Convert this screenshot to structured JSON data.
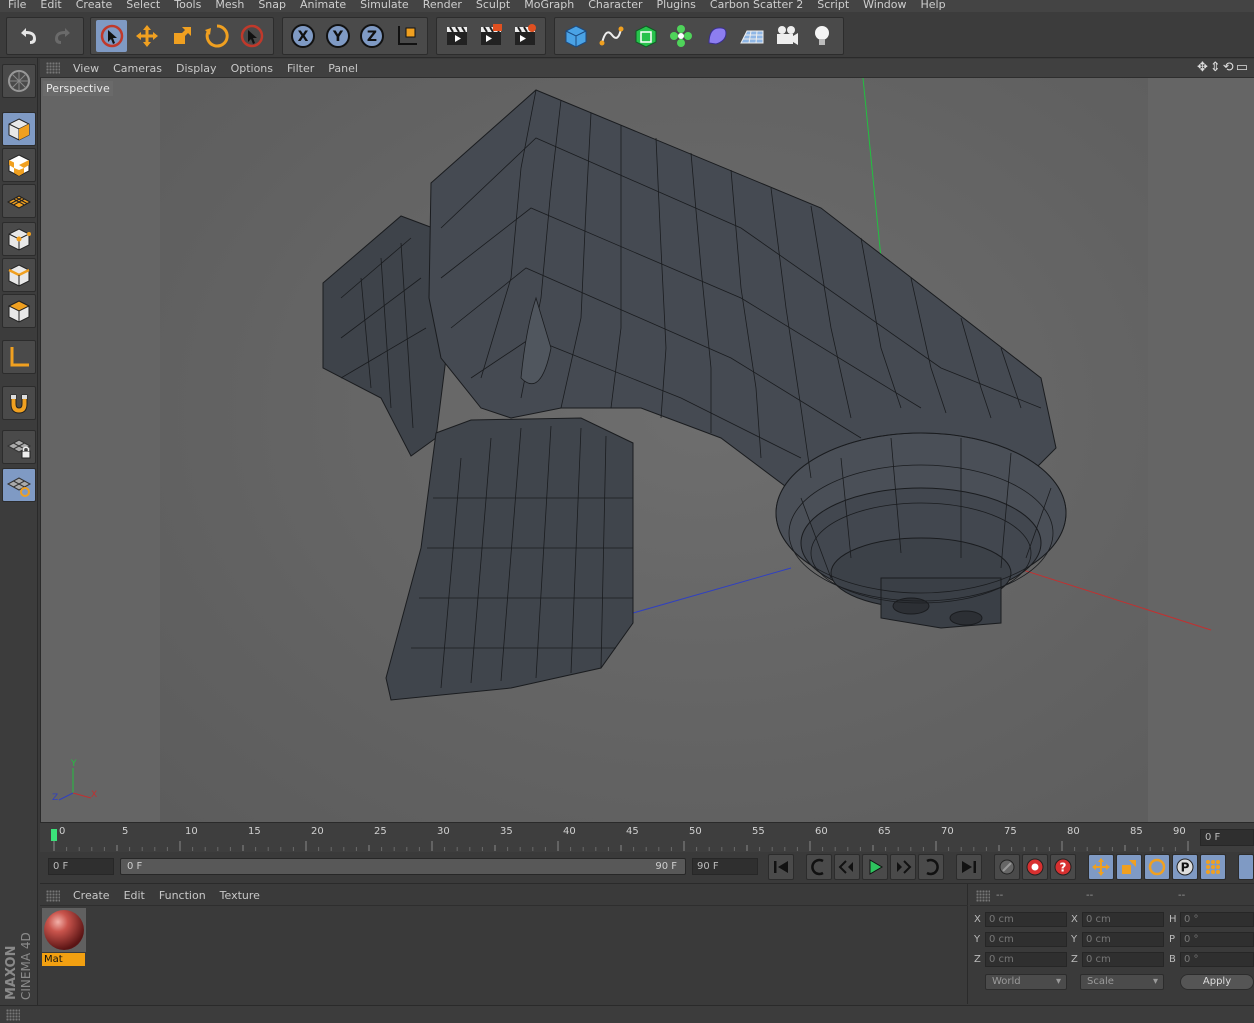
{
  "menu": [
    "File",
    "Edit",
    "Create",
    "Select",
    "Tools",
    "Mesh",
    "Snap",
    "Animate",
    "Simulate",
    "Render",
    "Sculpt",
    "MoGraph",
    "Character",
    "Plugins",
    "Carbon Scatter 2",
    "Script",
    "Window",
    "Help"
  ],
  "toolbar": {
    "axis_x": "X",
    "axis_y": "Y",
    "axis_z": "Z"
  },
  "viewport": {
    "menu": [
      "View",
      "Cameras",
      "Display",
      "Options",
      "Filter",
      "Panel"
    ],
    "camera_label": "Perspective",
    "axis_y": "Y",
    "axis_z": "Z",
    "axis_x": "X"
  },
  "timeline": {
    "ticks": [
      "0",
      "5",
      "10",
      "15",
      "20",
      "25",
      "30",
      "35",
      "40",
      "45",
      "50",
      "55",
      "60",
      "65",
      "70",
      "75",
      "80",
      "85",
      "90"
    ],
    "current_frame": "0 F"
  },
  "transport": {
    "start_field": "0 F",
    "range_start": "0 F",
    "range_end": "90 F",
    "end_field": "90 F"
  },
  "material_manager": {
    "menu": [
      "Create",
      "Edit",
      "Function",
      "Texture"
    ],
    "material_name": "Mat"
  },
  "coordinates": {
    "header": [
      "--",
      "--",
      "--"
    ],
    "pos_labels": [
      "X",
      "Y",
      "Z"
    ],
    "size_labels": [
      "X",
      "Y",
      "Z"
    ],
    "rot_labels": [
      "H",
      "P",
      "B"
    ],
    "pos_values": [
      "0 cm",
      "0 cm",
      "0 cm"
    ],
    "size_values": [
      "0 cm",
      "0 cm",
      "0 cm"
    ],
    "rot_values": [
      "0 °",
      "0 °",
      "0 °"
    ],
    "space_select": "World",
    "mode_select": "Scale",
    "apply_label": "Apply"
  },
  "brand": {
    "line1": "MAXON",
    "line2": "CINEMA 4D"
  },
  "colors": {
    "accent": "#7f9ac4",
    "timeline_marker": "#3be27a",
    "material_label": "#f2a011",
    "icon_orange": "#f0a020"
  }
}
